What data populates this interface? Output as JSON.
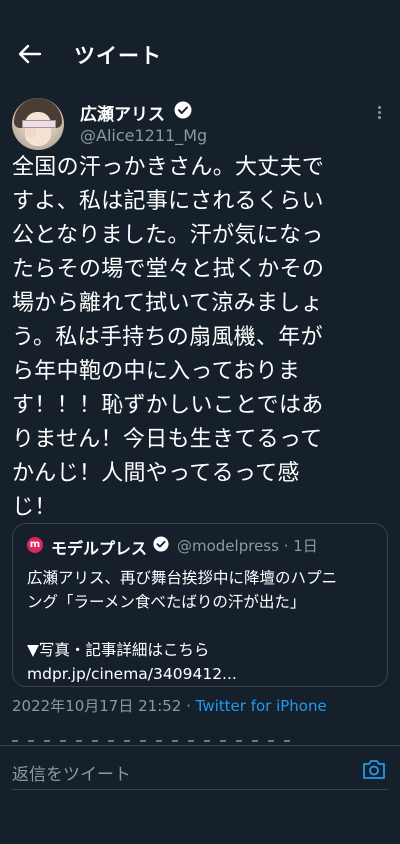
{
  "header": {
    "title": "ツイート"
  },
  "tweet": {
    "author_name": "広瀬アリス",
    "author_handle": "@Alice1211_Mg",
    "text": "全国の汗っかきさん。大丈夫で\nすよ、私は記事にされるくらい\n公となりました。汗が気になっ\nたらその場で堂々と拭くかその\n場から離れて拭いて涼みましょ\nう。私は手持ちの扇風機、年が\nら年中鞄の中に入っておりま\nす！！！恥ずかしいことではあ\nりません！今日も生きてるって\nかんじ！人間やってるって感\nじ！",
    "timestamp": "2022年10月17日 21:52",
    "separator": " · ",
    "source": "Twitter for iPhone"
  },
  "quoted": {
    "logo_letter": "m",
    "name": "モデルプレス",
    "handle_time": "@modelpress · 1日",
    "text": "広瀬アリス、再び舞台挨拶中に降壇のハプニ\nング「ラーメン食べたばりの汗が出た」\n\n▼写真・記事詳細はこちら\nmdpr.jp/cinema/3409412..."
  },
  "reply": {
    "placeholder": "返信をツイート"
  },
  "colors": {
    "background": "#15202b",
    "accent": "#1d9bf0",
    "muted": "#8b98a5",
    "border": "#38444d"
  }
}
